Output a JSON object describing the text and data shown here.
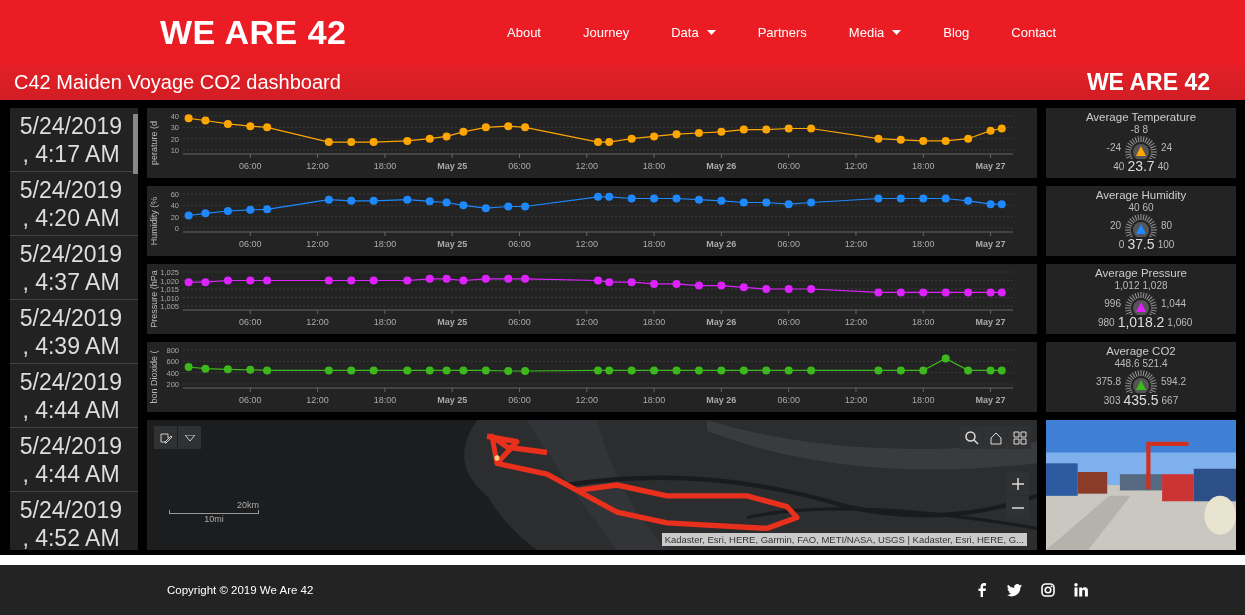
{
  "header": {
    "logo": "WE ARE 42",
    "nav": [
      {
        "label": "About",
        "dropdown": false
      },
      {
        "label": "Journey",
        "dropdown": false
      },
      {
        "label": "Data",
        "dropdown": true
      },
      {
        "label": "Partners",
        "dropdown": false
      },
      {
        "label": "Media",
        "dropdown": true
      },
      {
        "label": "Blog",
        "dropdown": false
      },
      {
        "label": "Contact",
        "dropdown": false
      }
    ]
  },
  "title_bar": {
    "title": "C42 Maiden Voyage CO2 dashboard",
    "logo": "WE ARE 42"
  },
  "timestamps": [
    {
      "date": "5/24/2019",
      "time": ", 4:17 AM"
    },
    {
      "date": "5/24/2019",
      "time": ", 4:20 AM"
    },
    {
      "date": "5/24/2019",
      "time": ", 4:37 AM"
    },
    {
      "date": "5/24/2019",
      "time": ", 4:39 AM"
    },
    {
      "date": "5/24/2019",
      "time": ", 4:44 AM"
    },
    {
      "date": "5/24/2019",
      "time": ", 4:44 AM"
    },
    {
      "date": "5/24/2019",
      "time": ", 4:52 AM"
    }
  ],
  "charts": [
    {
      "chart_data": {
        "type": "line",
        "ylabel": "perature (d",
        "grid": true,
        "x": [
          "2019-05-24T00:30",
          "2019-05-24T02:00",
          "2019-05-24T04:00",
          "2019-05-24T06:00",
          "2019-05-24T07:30",
          "2019-05-24T13:00",
          "2019-05-24T15:00",
          "2019-05-24T17:00",
          "2019-05-24T20:00",
          "2019-05-24T22:00",
          "2019-05-24T23:30",
          "2019-05-25T01:00",
          "2019-05-25T03:00",
          "2019-05-25T05:00",
          "2019-05-25T06:30",
          "2019-05-25T13:00",
          "2019-05-25T14:00",
          "2019-05-25T16:00",
          "2019-05-25T18:00",
          "2019-05-25T20:00",
          "2019-05-25T22:00",
          "2019-05-26T00:00",
          "2019-05-26T02:00",
          "2019-05-26T04:00",
          "2019-05-26T06:00",
          "2019-05-26T08:00",
          "2019-05-26T14:00",
          "2019-05-26T16:00",
          "2019-05-26T18:00",
          "2019-05-26T20:00",
          "2019-05-26T22:00",
          "2019-05-27T00:00",
          "2019-05-27T01:00"
        ],
        "xlim": [
          "2019-05-24T00:00",
          "2019-05-27T02:00"
        ],
        "ylim": [
          10,
          40
        ],
        "yticks": [
          10,
          20,
          30,
          40
        ],
        "xticks": [
          {
            "value": "2019-05-24T06:00",
            "label": "06:00"
          },
          {
            "value": "2019-05-24T12:00",
            "label": "12:00"
          },
          {
            "value": "2019-05-24T18:00",
            "label": "18:00"
          },
          {
            "value": "2019-05-25T00:00",
            "label": "May 25"
          },
          {
            "value": "2019-05-25T06:00",
            "label": "06:00"
          },
          {
            "value": "2019-05-25T12:00",
            "label": "12:00"
          },
          {
            "value": "2019-05-25T18:00",
            "label": "18:00"
          },
          {
            "value": "2019-05-26T00:00",
            "label": "May 26"
          },
          {
            "value": "2019-05-26T06:00",
            "label": "06:00"
          },
          {
            "value": "2019-05-26T12:00",
            "label": "12:00"
          },
          {
            "value": "2019-05-26T18:00",
            "label": "18:00"
          },
          {
            "value": "2019-05-27T00:00",
            "label": "May 27"
          }
        ],
        "series": [
          {
            "color": "#ffa500",
            "marker": "circle",
            "values": [
              38,
              36,
              33,
              31,
              30,
              17,
              17,
              17,
              18,
              20,
              22,
              26,
              30,
              31,
              30,
              17,
              17,
              20,
              22,
              24,
              25,
              26,
              28,
              28,
              29,
              29,
              20,
              19,
              18,
              18,
              20,
              27,
              29
            ]
          }
        ]
      }
    },
    {
      "chart_data": {
        "type": "line",
        "ylabel": "Humidity (%",
        "grid": true,
        "x": [
          "2019-05-24T00:30",
          "2019-05-24T02:00",
          "2019-05-24T04:00",
          "2019-05-24T06:00",
          "2019-05-24T07:30",
          "2019-05-24T13:00",
          "2019-05-24T15:00",
          "2019-05-24T17:00",
          "2019-05-24T20:00",
          "2019-05-24T22:00",
          "2019-05-24T23:30",
          "2019-05-25T01:00",
          "2019-05-25T03:00",
          "2019-05-25T05:00",
          "2019-05-25T06:30",
          "2019-05-25T13:00",
          "2019-05-25T14:00",
          "2019-05-25T16:00",
          "2019-05-25T18:00",
          "2019-05-25T20:00",
          "2019-05-25T22:00",
          "2019-05-26T00:00",
          "2019-05-26T02:00",
          "2019-05-26T04:00",
          "2019-05-26T06:00",
          "2019-05-26T08:00",
          "2019-05-26T14:00",
          "2019-05-26T16:00",
          "2019-05-26T18:00",
          "2019-05-26T20:00",
          "2019-05-26T22:00",
          "2019-05-27T00:00",
          "2019-05-27T01:00"
        ],
        "xlim": [
          "2019-05-24T00:00",
          "2019-05-27T02:00"
        ],
        "ylim": [
          0,
          60
        ],
        "yticks": [
          0,
          20,
          40,
          60
        ],
        "xticks": [
          {
            "value": "2019-05-24T06:00",
            "label": "06:00"
          },
          {
            "value": "2019-05-24T12:00",
            "label": "12:00"
          },
          {
            "value": "2019-05-24T18:00",
            "label": "18:00"
          },
          {
            "value": "2019-05-25T00:00",
            "label": "May 25"
          },
          {
            "value": "2019-05-25T06:00",
            "label": "06:00"
          },
          {
            "value": "2019-05-25T12:00",
            "label": "12:00"
          },
          {
            "value": "2019-05-25T18:00",
            "label": "18:00"
          },
          {
            "value": "2019-05-26T00:00",
            "label": "May 26"
          },
          {
            "value": "2019-05-26T06:00",
            "label": "06:00"
          },
          {
            "value": "2019-05-26T12:00",
            "label": "12:00"
          },
          {
            "value": "2019-05-26T18:00",
            "label": "18:00"
          },
          {
            "value": "2019-05-27T00:00",
            "label": "May 27"
          }
        ],
        "series": [
          {
            "color": "#1e88ff",
            "marker": "circle",
            "values": [
              22,
              26,
              30,
              32,
              33,
              50,
              48,
              48,
              50,
              47,
              45,
              40,
              35,
              38,
              38,
              55,
              55,
              52,
              52,
              52,
              50,
              48,
              45,
              45,
              42,
              45,
              52,
              52,
              52,
              52,
              48,
              42,
              42
            ]
          }
        ]
      }
    },
    {
      "chart_data": {
        "type": "line",
        "ylabel": "Pressure (hPa",
        "grid": true,
        "x": [
          "2019-05-24T00:30",
          "2019-05-24T02:00",
          "2019-05-24T04:00",
          "2019-05-24T06:00",
          "2019-05-24T07:30",
          "2019-05-24T13:00",
          "2019-05-24T15:00",
          "2019-05-24T17:00",
          "2019-05-24T20:00",
          "2019-05-24T22:00",
          "2019-05-24T23:30",
          "2019-05-25T01:00",
          "2019-05-25T03:00",
          "2019-05-25T05:00",
          "2019-05-25T06:30",
          "2019-05-25T13:00",
          "2019-05-25T14:00",
          "2019-05-25T16:00",
          "2019-05-25T18:00",
          "2019-05-25T20:00",
          "2019-05-25T22:00",
          "2019-05-26T00:00",
          "2019-05-26T02:00",
          "2019-05-26T04:00",
          "2019-05-26T06:00",
          "2019-05-26T08:00",
          "2019-05-26T14:00",
          "2019-05-26T16:00",
          "2019-05-26T18:00",
          "2019-05-26T20:00",
          "2019-05-26T22:00",
          "2019-05-27T00:00",
          "2019-05-27T01:00"
        ],
        "xlim": [
          "2019-05-24T00:00",
          "2019-05-27T02:00"
        ],
        "ylim": [
          1005,
          1025
        ],
        "yticks": [
          {
            "value": 1005,
            "label": "1,005"
          },
          {
            "value": 1010,
            "label": "1,010"
          },
          {
            "value": 1015,
            "label": "1,015"
          },
          {
            "value": 1020,
            "label": "1,020"
          },
          {
            "value": 1025,
            "label": "1,025"
          }
        ],
        "xticks": [
          {
            "value": "2019-05-24T06:00",
            "label": "06:00"
          },
          {
            "value": "2019-05-24T12:00",
            "label": "12:00"
          },
          {
            "value": "2019-05-24T18:00",
            "label": "18:00"
          },
          {
            "value": "2019-05-25T00:00",
            "label": "May 25"
          },
          {
            "value": "2019-05-25T06:00",
            "label": "06:00"
          },
          {
            "value": "2019-05-25T12:00",
            "label": "12:00"
          },
          {
            "value": "2019-05-25T18:00",
            "label": "18:00"
          },
          {
            "value": "2019-05-26T00:00",
            "label": "May 26"
          },
          {
            "value": "2019-05-26T06:00",
            "label": "06:00"
          },
          {
            "value": "2019-05-26T12:00",
            "label": "12:00"
          },
          {
            "value": "2019-05-26T18:00",
            "label": "18:00"
          },
          {
            "value": "2019-05-27T00:00",
            "label": "May 27"
          }
        ],
        "series": [
          {
            "color": "#dd22ff",
            "marker": "circle",
            "values": [
              1019,
              1019,
              1020,
              1020,
              1020,
              1020,
              1020,
              1020,
              1020,
              1021,
              1021,
              1020,
              1021,
              1021,
              1021,
              1020,
              1019,
              1019,
              1018,
              1018,
              1017,
              1017,
              1016,
              1015,
              1015,
              1015,
              1013,
              1013,
              1013,
              1013,
              1013,
              1013,
              1013
            ]
          }
        ]
      }
    },
    {
      "chart_data": {
        "type": "line",
        "ylabel": "bon Dioxide (",
        "grid": true,
        "x": [
          "2019-05-24T00:30",
          "2019-05-24T02:00",
          "2019-05-24T04:00",
          "2019-05-24T06:00",
          "2019-05-24T07:30",
          "2019-05-24T13:00",
          "2019-05-24T15:00",
          "2019-05-24T17:00",
          "2019-05-24T20:00",
          "2019-05-24T22:00",
          "2019-05-24T23:30",
          "2019-05-25T01:00",
          "2019-05-25T03:00",
          "2019-05-25T05:00",
          "2019-05-25T06:30",
          "2019-05-25T13:00",
          "2019-05-25T14:00",
          "2019-05-25T16:00",
          "2019-05-25T18:00",
          "2019-05-25T20:00",
          "2019-05-25T22:00",
          "2019-05-26T00:00",
          "2019-05-26T02:00",
          "2019-05-26T04:00",
          "2019-05-26T06:00",
          "2019-05-26T08:00",
          "2019-05-26T14:00",
          "2019-05-26T16:00",
          "2019-05-26T18:00",
          "2019-05-26T20:00",
          "2019-05-26T22:00",
          "2019-05-27T00:00",
          "2019-05-27T01:00"
        ],
        "xlim": [
          "2019-05-24T00:00",
          "2019-05-27T02:00"
        ],
        "ylim": [
          200,
          800
        ],
        "yticks": [
          200,
          400,
          600,
          800
        ],
        "xticks": [
          {
            "value": "2019-05-24T06:00",
            "label": "06:00"
          },
          {
            "value": "2019-05-24T12:00",
            "label": "12:00"
          },
          {
            "value": "2019-05-24T18:00",
            "label": "18:00"
          },
          {
            "value": "2019-05-25T00:00",
            "label": "May 25"
          },
          {
            "value": "2019-05-25T06:00",
            "label": "06:00"
          },
          {
            "value": "2019-05-25T12:00",
            "label": "12:00"
          },
          {
            "value": "2019-05-25T18:00",
            "label": "18:00"
          },
          {
            "value": "2019-05-26T00:00",
            "label": "May 26"
          },
          {
            "value": "2019-05-26T06:00",
            "label": "06:00"
          },
          {
            "value": "2019-05-26T12:00",
            "label": "12:00"
          },
          {
            "value": "2019-05-26T18:00",
            "label": "18:00"
          },
          {
            "value": "2019-05-27T00:00",
            "label": "May 27"
          }
        ],
        "series": [
          {
            "color": "#3cb81c",
            "marker": "circle",
            "values": [
              500,
              470,
              460,
              450,
              440,
              440,
              440,
              440,
              440,
              440,
              440,
              440,
              440,
              430,
              430,
              440,
              440,
              440,
              440,
              440,
              440,
              440,
              440,
              440,
              440,
              440,
              440,
              440,
              440,
              650,
              440,
              440,
              440
            ]
          }
        ]
      }
    }
  ],
  "gauges": [
    {
      "title": "Average Temperature",
      "color": "#ffa500",
      "scale": [
        "-8",
        "8",
        "-24",
        "24",
        "40",
        "40"
      ],
      "value": "23.7"
    },
    {
      "title": "Average Humidity",
      "color": "#1e88ff",
      "scale": [
        "40",
        "60",
        "20",
        "80",
        "0",
        "100"
      ],
      "value": "37.5"
    },
    {
      "title": "Average Pressure",
      "color": "#dd22ff",
      "scale": [
        "1,012",
        "1,028",
        "996",
        "1,044",
        "980",
        "1,060"
      ],
      "value": "1,018.2"
    },
    {
      "title": "Average CO2",
      "color": "#3cb81c",
      "scale": [
        "448.6",
        "521.4",
        "375.8",
        "594.2",
        "303",
        "667"
      ],
      "value": "435.5"
    }
  ],
  "map": {
    "kind": "picture",
    "scale_km": "20km",
    "scale_mi": "10mi",
    "attribution": "Kadaster, Esri, HERE, Garmin, FAO, METI/NASA, USGS | Kadaster, Esri, HERE, G..."
  },
  "footer": {
    "copyright": "Copyright © 2019 We Are 42"
  }
}
